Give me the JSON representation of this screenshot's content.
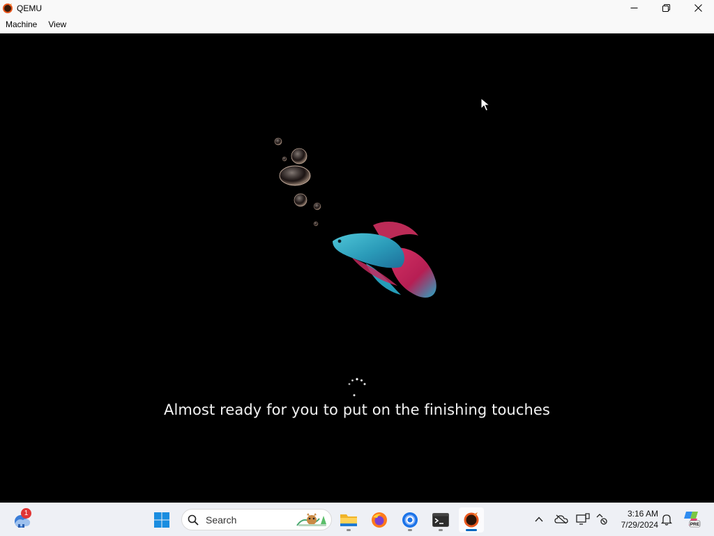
{
  "window": {
    "title": "QEMU",
    "menu": [
      "Machine",
      "View"
    ]
  },
  "screen": {
    "status_message": "Almost ready for you to put on the finishing touches",
    "background_color": "#000000"
  },
  "taskbar": {
    "widgets_badge": "1",
    "search_placeholder": "Search",
    "apps": [
      "start-icon",
      "file-explorer-icon",
      "firefox-icon",
      "chrome-icon",
      "terminal-icon",
      "qemu-icon"
    ],
    "tray_icons": [
      "chevron-up-icon",
      "onedrive-icon",
      "display-icon",
      "network-icon",
      "bell-icon",
      "copilot-icon"
    ],
    "time": "3:16 AM",
    "date": "7/29/2024",
    "copilot_badge": "PRE"
  },
  "colors": {
    "accent": "#0067c0",
    "taskbar_bg": "#eef0f5",
    "titlebar_bg": "#f9f9f9"
  }
}
